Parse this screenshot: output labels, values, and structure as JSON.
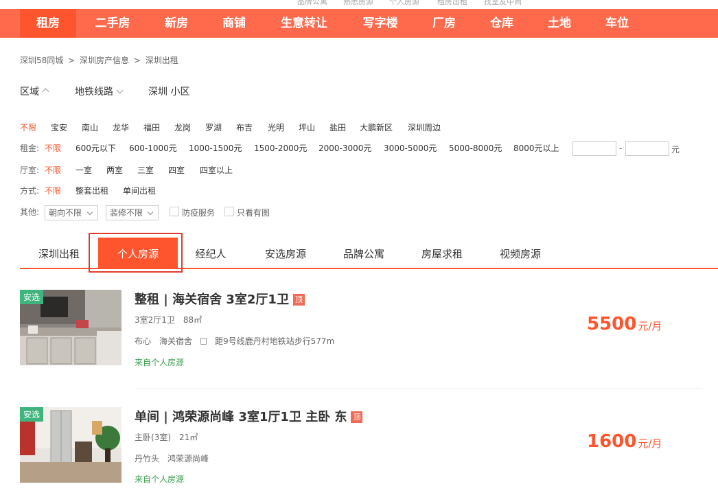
{
  "top_strip": [
    "品牌公寓",
    "熟悉房源",
    "个人房源",
    "租房出租",
    "找室友中间"
  ],
  "nav": [
    "租房",
    "二手房",
    "新房",
    "商铺",
    "生意转让",
    "写字楼",
    "厂房",
    "仓库",
    "土地",
    "车位"
  ],
  "breadcrumb": [
    "深圳58同城",
    ">",
    "深圳房产信息",
    ">",
    "深圳出租"
  ],
  "selectors": {
    "region": "区域",
    "subway": "地铁线路",
    "community": "深圳 小区"
  },
  "filters": {
    "districts": [
      "不限",
      "宝安",
      "南山",
      "龙华",
      "福田",
      "龙岗",
      "罗湖",
      "布吉",
      "光明",
      "坪山",
      "盐田",
      "大鹏新区",
      "深圳周边"
    ],
    "rent_label": "租金:",
    "rents": [
      "不限",
      "600元以下",
      "600-1000元",
      "1000-1500元",
      "1500-2000元",
      "2000-3000元",
      "3000-5000元",
      "5000-8000元",
      "8000元以上"
    ],
    "rent_dash": "-",
    "rent_unit": "元",
    "rooms_label": "厅室:",
    "rooms": [
      "不限",
      "一室",
      "两室",
      "三室",
      "四室",
      "四室以上"
    ],
    "mode_label": "方式:",
    "modes": [
      "不限",
      "整套出租",
      "单间出租"
    ],
    "other_label": "其他:",
    "orientation": "朝向不限",
    "decoration": "装修不限",
    "check_epidemic": "防疫服务",
    "check_pics": "只看有图"
  },
  "tabs": [
    "深圳出租",
    "个人房源",
    "经纪人",
    "安选房源",
    "品牌公寓",
    "房屋求租",
    "视频房源"
  ],
  "listings": [
    {
      "badge": "安选",
      "title": "整租 | 海关宿舍 3室2厅1卫",
      "top": "顶",
      "layout": "3室2厅1卫",
      "area": "88㎡",
      "district": "布心",
      "community": "海关宿舍",
      "subway": "距9号线鹿丹村地铁站步行577m",
      "source": "来自个人房源",
      "price": "5500",
      "unit": "元/月"
    },
    {
      "badge": "安选",
      "title": "单间 | 鸿荣源尚峰 3室1厅1卫 主卧 东",
      "top": "顶",
      "layout": "主卧(3室)",
      "area": "21㎡",
      "district": "丹竹头",
      "community": "鸿荣源尚峰",
      "subway": "",
      "source": "来自个人房源",
      "price": "1600",
      "unit": "元/月"
    }
  ],
  "colors": {
    "brand": "#ff552e",
    "nav_bg": "#ff6a4d",
    "badge": "#3fb57d",
    "source": "#3a9e4f"
  }
}
